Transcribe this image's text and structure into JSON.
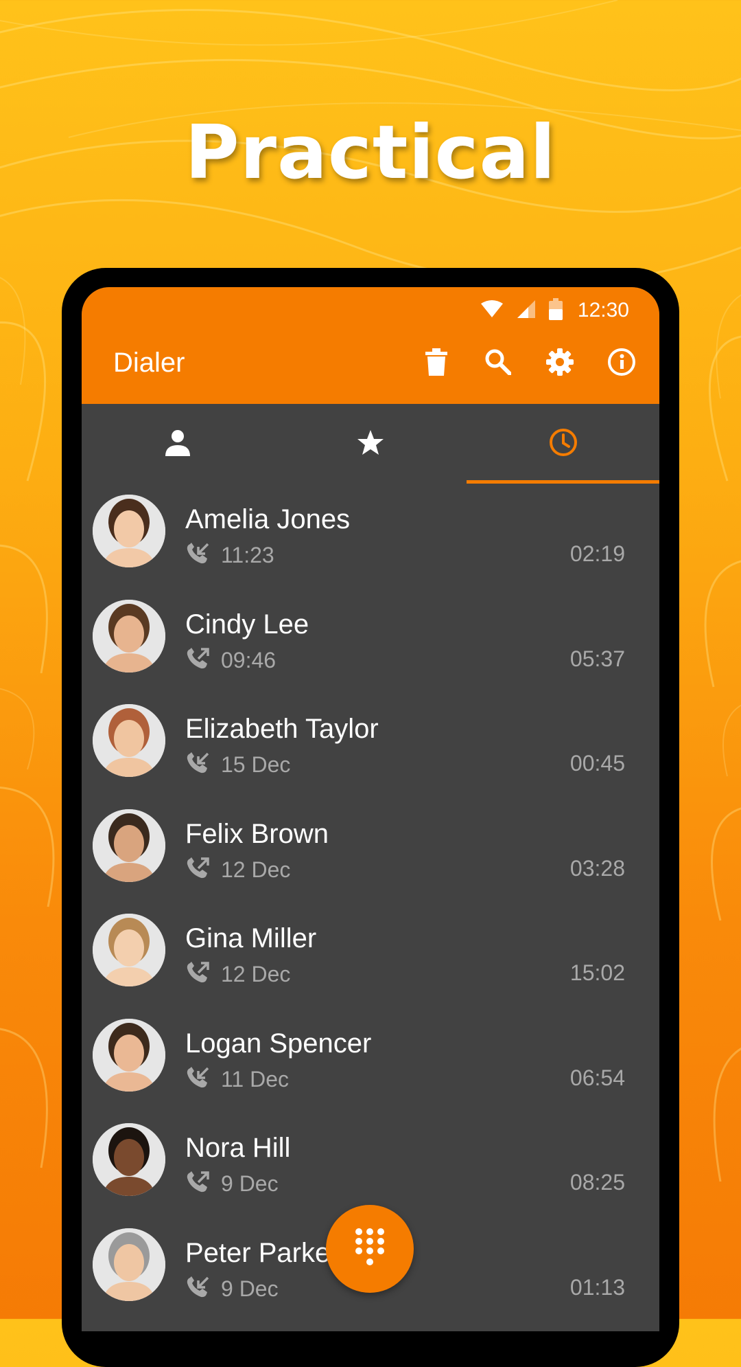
{
  "headline": "Practical",
  "status_bar": {
    "time": "12:30",
    "icons": [
      "wifi-icon",
      "signal-icon",
      "battery-icon"
    ]
  },
  "app_bar": {
    "title": "Dialer",
    "actions": [
      "delete-icon",
      "search-icon",
      "settings-icon",
      "info-icon"
    ]
  },
  "tabs": [
    {
      "icon": "person-icon",
      "active": false
    },
    {
      "icon": "star-icon",
      "active": false
    },
    {
      "icon": "clock-icon",
      "active": true
    }
  ],
  "colors": {
    "accent": "#F57C00",
    "surface": "#424242",
    "secondary_text": "#A9A9A9"
  },
  "calls": [
    {
      "name": "Amelia Jones",
      "direction": "incoming",
      "time": "11:23",
      "duration": "02:19"
    },
    {
      "name": "Cindy Lee",
      "direction": "outgoing",
      "time": "09:46",
      "duration": "05:37"
    },
    {
      "name": "Elizabeth Taylor",
      "direction": "incoming",
      "time": "15 Dec",
      "duration": "00:45"
    },
    {
      "name": "Felix Brown",
      "direction": "outgoing",
      "time": "12 Dec",
      "duration": "03:28"
    },
    {
      "name": "Gina Miller",
      "direction": "outgoing",
      "time": "12 Dec",
      "duration": "15:02"
    },
    {
      "name": "Logan Spencer",
      "direction": "incoming",
      "time": "11 Dec",
      "duration": "06:54"
    },
    {
      "name": "Nora Hill",
      "direction": "outgoing",
      "time": "9 Dec",
      "duration": "08:25"
    },
    {
      "name": "Peter Parker",
      "direction": "incoming",
      "time": "9 Dec",
      "duration": "01:13"
    }
  ],
  "fab": {
    "icon": "dialpad-icon"
  }
}
